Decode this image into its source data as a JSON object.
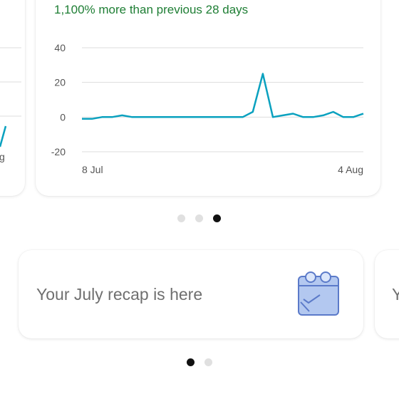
{
  "colors": {
    "growth_text": "#1e7e34",
    "line": "#0aa1bf",
    "grid": "#dddddd",
    "recap_text": "#6f6f6f",
    "dot_active": "#111111",
    "dot_inactive": "#e0e0e0",
    "calendar_fill": "#b3c8f0",
    "calendar_stroke": "#5b7ac9"
  },
  "stats_card": {
    "growth_text": "1,100% more than previous 28 days",
    "left_card_partial_tick": "g"
  },
  "chart_data": {
    "type": "line",
    "y_ticks": [
      "40",
      "20",
      "0",
      "-20"
    ],
    "x_tick_labels": [
      "8 Jul",
      "4 Aug"
    ],
    "ylim": [
      -20,
      40
    ],
    "grid": true,
    "series": [
      {
        "values": [
          -1,
          -1,
          0,
          0,
          1,
          0,
          0,
          0,
          0,
          0,
          0,
          0,
          0,
          0,
          0,
          0,
          0,
          3,
          25,
          0,
          1,
          2,
          0,
          0,
          1,
          3,
          0,
          0,
          2
        ]
      }
    ]
  },
  "pager_top": {
    "count": 3,
    "active_index": 2
  },
  "recap_card": {
    "title": "Your July recap is here",
    "icon": "calendar-check-icon",
    "next_card_partial_title": "Y"
  },
  "pager_bottom": {
    "count": 2,
    "active_index": 0
  }
}
